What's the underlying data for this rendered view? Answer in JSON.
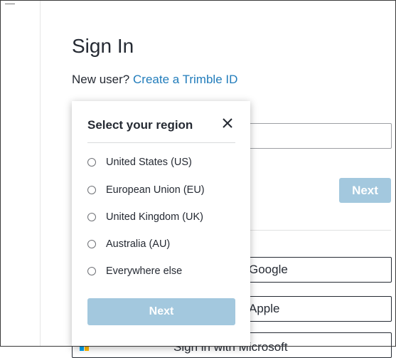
{
  "signin": {
    "title": "Sign In",
    "new_user_text": "New user?",
    "create_link": "Create a Trimble ID",
    "next_label": "Next",
    "google_label": "Google",
    "apple_label": "Apple",
    "microsoft_label": "Sign in with Microsoft"
  },
  "region_popup": {
    "title": "Select your region",
    "options": [
      "United States (US)",
      "European Union (EU)",
      "United Kingdom (UK)",
      "Australia (AU)",
      "Everywhere else"
    ],
    "next_label": "Next"
  },
  "colors": {
    "link": "#217cbb",
    "disabled_button": "#a3c8de",
    "text": "#252a33"
  }
}
